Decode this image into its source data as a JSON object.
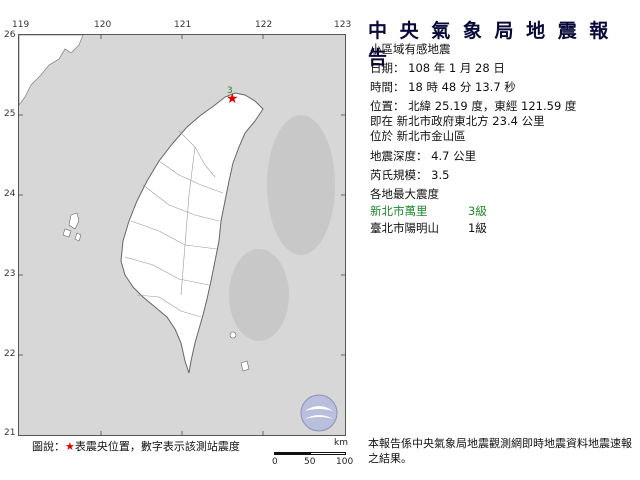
{
  "map": {
    "lon_ticks": [
      "119",
      "120",
      "121",
      "122",
      "123"
    ],
    "lat_ticks": [
      "26",
      "25",
      "24",
      "23",
      "22",
      "21"
    ],
    "epicenter_marker": "red-star",
    "station_marker_text": "3",
    "colors": {
      "land": "#ffffff",
      "sea": "#d7d7d7",
      "epicenter": "#e00000",
      "station": "#1d8a2a"
    }
  },
  "report": {
    "title": "中 央 氣 象 局 地 震 報 告",
    "subtitle": "小區域有感地震",
    "date_line": "日期： 108 年 1 月 28 日",
    "time_line": "時間： 18 時 48 分 13.7 秒",
    "position_line": "位置： 北緯 25.19 度，東經 121.59 度",
    "relative_line": "即在 新北市政府東北方 23.4 公里",
    "located_line": "位於 新北市金山區",
    "depth_line": "地震深度： 4.7 公里",
    "magnitude_line": "芮氏規模： 3.5",
    "intensity_header": "各地最大震度",
    "intensities": [
      {
        "place": "新北市萬里",
        "level": "3級"
      },
      {
        "place": "臺北市陽明山",
        "level": "1級"
      }
    ]
  },
  "legend": {
    "prefix": "圖說：",
    "star": "★",
    "text": "表震央位置，數字表示該測站震度"
  },
  "scalebar": {
    "unit": "km",
    "labels": [
      "0",
      "50",
      "100"
    ]
  },
  "note": "本報告係中央氣象局地震觀測網即時地震資料地震速報之結果。"
}
